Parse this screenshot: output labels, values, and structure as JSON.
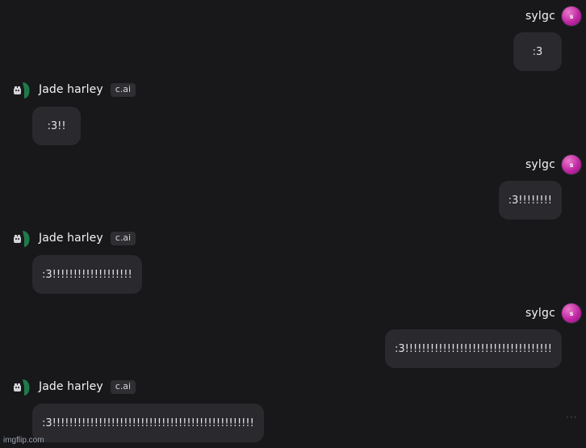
{
  "user": {
    "name": "sylgc",
    "avatar_initial": "s"
  },
  "bot": {
    "name": "Jade harley",
    "badge": "c.ai"
  },
  "messages": [
    {
      "sender": "user",
      "text": ":3"
    },
    {
      "sender": "bot",
      "text": ":3!!"
    },
    {
      "sender": "user",
      "text": ":3!!!!!!!!"
    },
    {
      "sender": "bot",
      "text": ":3!!!!!!!!!!!!!!!!!!!"
    },
    {
      "sender": "user",
      "text": ":3!!!!!!!!!!!!!!!!!!!!!!!!!!!!!!!!!!!"
    },
    {
      "sender": "bot",
      "text": ":3!!!!!!!!!!!!!!!!!!!!!!!!!!!!!!!!!!!!!!!!!!!!!!!!"
    }
  ],
  "more_icon": "more-horizontal-icon",
  "watermark": "imgflip.com",
  "colors": {
    "background": "#18181b",
    "bubble": "#2a2a2e",
    "user_avatar": "#c026a3",
    "bot_avatar_hair": "#1f7a4a"
  }
}
